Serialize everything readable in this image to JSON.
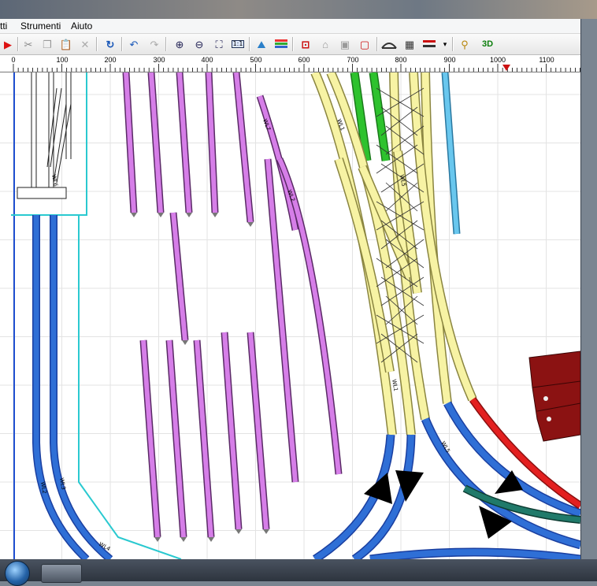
{
  "menu": {
    "items": [
      "tti",
      "Strumenti",
      "Aiuto"
    ]
  },
  "toolbar": {
    "buttons": [
      "run",
      "scissors",
      "copy",
      "paste",
      "delete",
      "rotate",
      "undo",
      "redo",
      "zoom-in",
      "zoom-out",
      "zoom-fit",
      "zoom-1to1",
      "terrain",
      "layers",
      "signal",
      "object-1",
      "object-2",
      "object-3",
      "object-4",
      "bridge",
      "grid",
      "track-style",
      "dropdown",
      "inspect",
      "3d"
    ],
    "zoom_1to1_label": "1:1",
    "threed_label": "3D"
  },
  "ruler": {
    "labels": [
      "0",
      "100",
      "200",
      "300",
      "400",
      "500",
      "600",
      "700",
      "800",
      "900",
      "1000",
      "1100"
    ]
  },
  "track_labels": [
    "WL1",
    "WL1",
    "WL2",
    "WL2",
    "WL3",
    "WL4",
    "WL5",
    "WL5",
    "WL6",
    "WL7"
  ],
  "colors": {
    "blue_track": "#2f6fd6",
    "purple_track": "#d67ee8",
    "yellow_track": "#f7f3a4",
    "green_track": "#2ec22e",
    "cyan_track": "#69c7ee",
    "red_track": "#e32020",
    "teal_track": "#207a6a",
    "building": "#8b1212"
  }
}
